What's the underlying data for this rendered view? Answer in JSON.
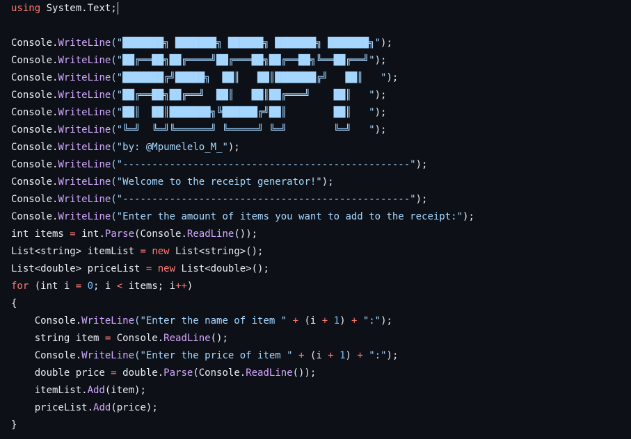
{
  "code": {
    "lines": [
      [
        {
          "t": "using",
          "c": "kw"
        },
        {
          "t": " System.Text;"
        }
      ],
      [],
      [
        {
          "t": "Console."
        },
        {
          "t": "WriteLine",
          "c": "fn"
        },
        {
          "t": "(\"███████╗ ███████╗ ██████╗ ███████╗ ███████╗\"",
          "c": "str"
        },
        {
          "t": ");"
        }
      ],
      [
        {
          "t": "Console."
        },
        {
          "t": "WriteLine",
          "c": "fn"
        },
        {
          "t": "(\"██╔══██╗██╔════╝██╔═══██╗██╔══██╗╚══██╔══╝\"",
          "c": "str"
        },
        {
          "t": ");"
        }
      ],
      [
        {
          "t": "Console."
        },
        {
          "t": "WriteLine",
          "c": "fn"
        },
        {
          "t": "(\"███████╔╝█████╗  ██║   ██║███████╔╝   ██║   \"",
          "c": "str"
        },
        {
          "t": ");"
        }
      ],
      [
        {
          "t": "Console."
        },
        {
          "t": "WriteLine",
          "c": "fn"
        },
        {
          "t": "(\"██╔══██╗██╔══╝  ██║   ██║██╔═══╝    ██║   \"",
          "c": "str"
        },
        {
          "t": ");"
        }
      ],
      [
        {
          "t": "Console."
        },
        {
          "t": "WriteLine",
          "c": "fn"
        },
        {
          "t": "(\"██║  ██║███████╗╚██████╔╝██║        ██║   \"",
          "c": "str"
        },
        {
          "t": ");"
        }
      ],
      [
        {
          "t": "Console."
        },
        {
          "t": "WriteLine",
          "c": "fn"
        },
        {
          "t": "(\"╚═╝  ╚═╝╚══════╝ ╚═════╝ ╚═╝        ╚═╝   \"",
          "c": "str"
        },
        {
          "t": ");"
        }
      ],
      [
        {
          "t": "Console."
        },
        {
          "t": "WriteLine",
          "c": "fn"
        },
        {
          "t": "(\"by: @Mpumelelo_M_\"",
          "c": "str"
        },
        {
          "t": ");"
        }
      ],
      [
        {
          "t": "Console."
        },
        {
          "t": "WriteLine",
          "c": "fn"
        },
        {
          "t": "(\"-------------------------------------------------\"",
          "c": "str"
        },
        {
          "t": ");"
        }
      ],
      [
        {
          "t": "Console."
        },
        {
          "t": "WriteLine",
          "c": "fn"
        },
        {
          "t": "(\"Welcome to the receipt generator!\"",
          "c": "str"
        },
        {
          "t": ");"
        }
      ],
      [
        {
          "t": "Console."
        },
        {
          "t": "WriteLine",
          "c": "fn"
        },
        {
          "t": "(\"-------------------------------------------------\"",
          "c": "str"
        },
        {
          "t": ");"
        }
      ],
      [
        {
          "t": "Console."
        },
        {
          "t": "WriteLine",
          "c": "fn"
        },
        {
          "t": "(\"Enter the amount of items you want to add to the receipt:\"",
          "c": "str"
        },
        {
          "t": ");"
        }
      ],
      [
        {
          "t": "int items "
        },
        {
          "t": "=",
          "c": "kw"
        },
        {
          "t": " int."
        },
        {
          "t": "Parse",
          "c": "fn"
        },
        {
          "t": "(Console."
        },
        {
          "t": "ReadLine",
          "c": "fn"
        },
        {
          "t": "());"
        }
      ],
      [
        {
          "t": "List<string> itemList "
        },
        {
          "t": "=",
          "c": "kw"
        },
        {
          "t": " "
        },
        {
          "t": "new",
          "c": "kw"
        },
        {
          "t": " List<string>();"
        }
      ],
      [
        {
          "t": "List<double> priceList "
        },
        {
          "t": "=",
          "c": "kw"
        },
        {
          "t": " "
        },
        {
          "t": "new",
          "c": "kw"
        },
        {
          "t": " List<double>();"
        }
      ],
      [
        {
          "t": "for",
          "c": "kw"
        },
        {
          "t": " (int i "
        },
        {
          "t": "=",
          "c": "kw"
        },
        {
          "t": " "
        },
        {
          "t": "0",
          "c": "num"
        },
        {
          "t": "; i "
        },
        {
          "t": "<",
          "c": "kw"
        },
        {
          "t": " items; i"
        },
        {
          "t": "++",
          "c": "kw"
        },
        {
          "t": ")"
        }
      ],
      [
        {
          "t": "{"
        }
      ],
      [
        {
          "t": "    Console."
        },
        {
          "t": "WriteLine",
          "c": "fn"
        },
        {
          "t": "(\"Enter the name of item \"",
          "c": "str"
        },
        {
          "t": " "
        },
        {
          "t": "+",
          "c": "kw"
        },
        {
          "t": " (i "
        },
        {
          "t": "+",
          "c": "kw"
        },
        {
          "t": " "
        },
        {
          "t": "1",
          "c": "num"
        },
        {
          "t": ") "
        },
        {
          "t": "+",
          "c": "kw"
        },
        {
          "t": " "
        },
        {
          "t": "\":\"",
          "c": "str"
        },
        {
          "t": ");"
        }
      ],
      [
        {
          "t": "    string item "
        },
        {
          "t": "=",
          "c": "kw"
        },
        {
          "t": " Console."
        },
        {
          "t": "ReadLine",
          "c": "fn"
        },
        {
          "t": "();"
        }
      ],
      [
        {
          "t": "    Console."
        },
        {
          "t": "WriteLine",
          "c": "fn"
        },
        {
          "t": "(\"Enter the price of item \"",
          "c": "str"
        },
        {
          "t": " "
        },
        {
          "t": "+",
          "c": "kw"
        },
        {
          "t": " (i "
        },
        {
          "t": "+",
          "c": "kw"
        },
        {
          "t": " "
        },
        {
          "t": "1",
          "c": "num"
        },
        {
          "t": ") "
        },
        {
          "t": "+",
          "c": "kw"
        },
        {
          "t": " "
        },
        {
          "t": "\":\"",
          "c": "str"
        },
        {
          "t": ");"
        }
      ],
      [
        {
          "t": "    double price "
        },
        {
          "t": "=",
          "c": "kw"
        },
        {
          "t": " double."
        },
        {
          "t": "Parse",
          "c": "fn"
        },
        {
          "t": "(Console."
        },
        {
          "t": "ReadLine",
          "c": "fn"
        },
        {
          "t": "());"
        }
      ],
      [
        {
          "t": "    itemList."
        },
        {
          "t": "Add",
          "c": "fn"
        },
        {
          "t": "(item);"
        }
      ],
      [
        {
          "t": "    priceList."
        },
        {
          "t": "Add",
          "c": "fn"
        },
        {
          "t": "(price);"
        }
      ],
      [
        {
          "t": "}"
        }
      ]
    ]
  },
  "colors": {
    "background": "#0d1117",
    "text": "#e6edf3",
    "keyword": "#ff7b72",
    "method": "#d2a8ff",
    "string": "#a5d6ff",
    "number": "#79c0ff"
  }
}
